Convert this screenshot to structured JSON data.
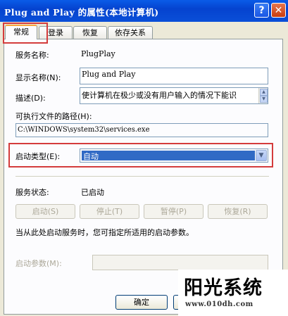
{
  "window": {
    "title": "Plug and Play 的属性(本地计算机)"
  },
  "tabs": [
    {
      "label": "常规"
    },
    {
      "label": "登录"
    },
    {
      "label": "恢复"
    },
    {
      "label": "依存关系"
    }
  ],
  "general": {
    "service_name_label": "服务名称:",
    "service_name_value": "PlugPlay",
    "display_name_label": "显示名称(N):",
    "display_name_value": "Plug and Play",
    "description_label": "描述(D):",
    "description_value": "使计算机在极少或没有用户输入的情况下能识",
    "exe_path_label": "可执行文件的路径(H):",
    "exe_path_value": "C:\\WINDOWS\\system32\\services.exe",
    "startup_type_label": "启动类型(E):",
    "startup_type_value": "自动",
    "service_status_label": "服务状态:",
    "service_status_value": "已启动",
    "buttons": {
      "start": "启动(S)",
      "stop": "停止(T)",
      "pause": "暂停(P)",
      "resume": "恢复(R)"
    },
    "hint_text": "当从此处启动服务时，您可指定所适用的启动参数。",
    "start_params_label": "启动参数(M):",
    "start_params_value": ""
  },
  "footer": {
    "ok_label": "确定"
  },
  "watermark": {
    "title": "阳光系统",
    "url": "www.010dh.com"
  },
  "colors": {
    "titlebar": "#0a4fd8",
    "highlight_box": "#d43c3c",
    "selection": "#316ac5",
    "dialog_bg": "#ece9d8"
  }
}
